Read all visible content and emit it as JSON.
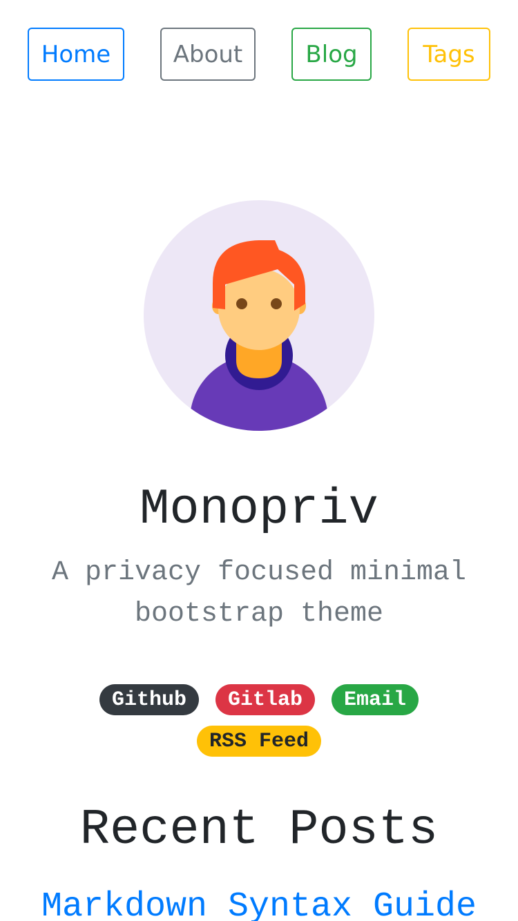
{
  "nav": {
    "home": "Home",
    "about": "About",
    "blog": "Blog",
    "tags": "Tags"
  },
  "profile": {
    "title": "Monopriv",
    "subtitle": "A privacy focused minimal bootstrap theme",
    "avatar_icon": "person-avatar-icon"
  },
  "links": {
    "github": "Github",
    "gitlab": "Gitlab",
    "email": "Email",
    "rss": "RSS Feed"
  },
  "recent_posts": {
    "heading": "Recent Posts",
    "items": [
      {
        "title": "Markdown Syntax Guide"
      }
    ]
  },
  "colors": {
    "primary": "#007bff",
    "secondary": "#6c757d",
    "success": "#28a745",
    "warning": "#ffc107",
    "danger": "#dc3545",
    "dark": "#343a40"
  }
}
